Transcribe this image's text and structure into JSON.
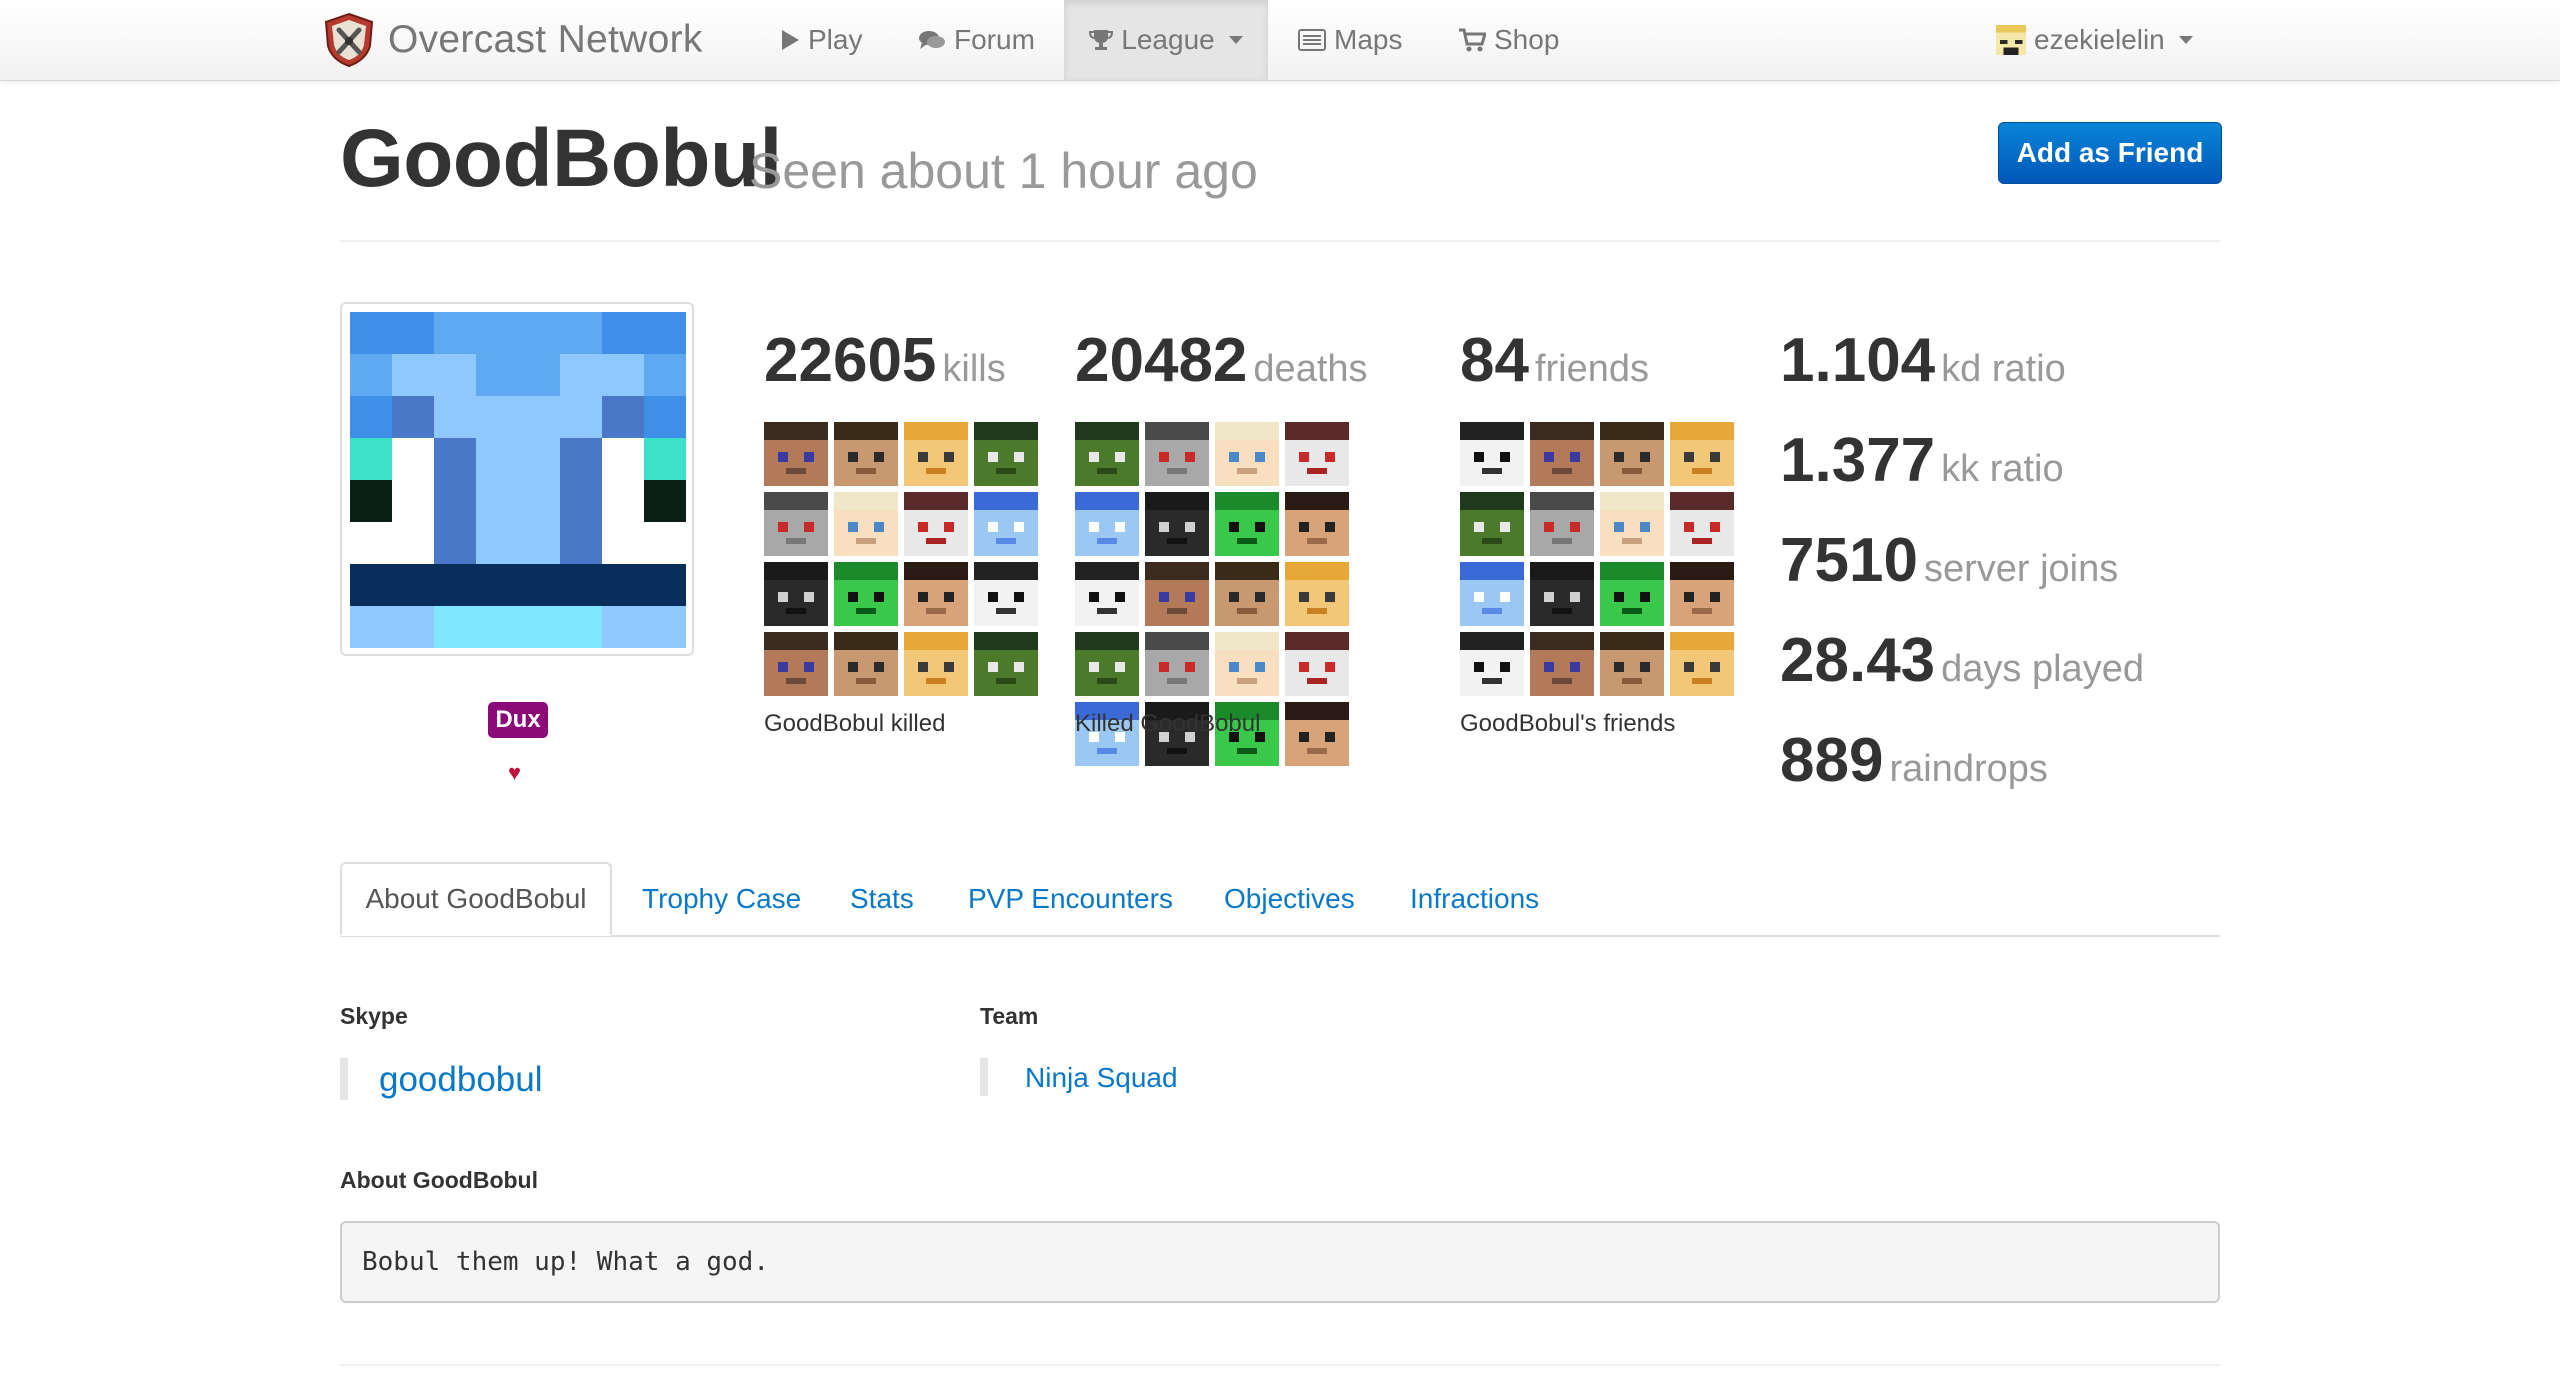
{
  "nav": {
    "brand": "Overcast Network",
    "items": [
      {
        "label": "Play",
        "icon": "play-icon"
      },
      {
        "label": "Forum",
        "icon": "comments-icon"
      },
      {
        "label": "League",
        "icon": "trophy-icon"
      },
      {
        "label": "Maps",
        "icon": "list-icon"
      },
      {
        "label": "Shop",
        "icon": "cart-icon"
      }
    ],
    "user": "ezekielelin"
  },
  "profile": {
    "name": "GoodBobul",
    "seen": "Seen about 1 hour ago",
    "add_friend": "Add as Friend",
    "badge": "Dux",
    "heart": "♥"
  },
  "stats": {
    "kills": {
      "value": "22605",
      "unit": "kills",
      "caption": "GoodBobul killed"
    },
    "deaths": {
      "value": "20482",
      "unit": "deaths",
      "caption": "Killed GoodBobul"
    },
    "friends": {
      "value": "84",
      "unit": "friends",
      "caption": "GoodBobul's friends"
    },
    "kd": {
      "value": "1.104",
      "unit": "kd ratio"
    },
    "kk": {
      "value": "1.377",
      "unit": "kk ratio"
    },
    "joins": {
      "value": "7510",
      "unit": "server joins"
    },
    "days": {
      "value": "28.43",
      "unit": "days played"
    },
    "raindrops": {
      "value": "889",
      "unit": "raindrops"
    }
  },
  "tabs": [
    "About GoodBobul",
    "Trophy Case",
    "Stats",
    "PVP Encounters",
    "Objectives",
    "Infractions"
  ],
  "about": {
    "skype_label": "Skype",
    "skype_value": "goodbobul",
    "team_label": "Team",
    "team_value": "Ninja Squad",
    "about_label": "About GoodBobul",
    "about_text": "Bobul them up! What a god."
  },
  "colors": {
    "link": "#0a78c8",
    "button": "#0a6fd0",
    "badge": "#8b0a78",
    "heart": "#c0143c"
  }
}
